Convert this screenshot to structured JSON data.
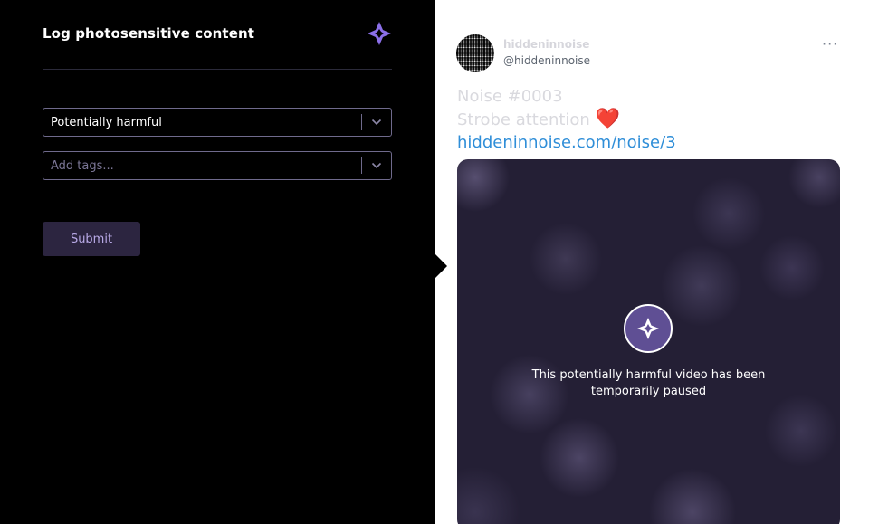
{
  "panel": {
    "title": "Log photosensitive content",
    "severity_select": {
      "value": "Potentially harmful"
    },
    "tags_select": {
      "placeholder": "Add tags..."
    },
    "submit_label": "Submit",
    "colors": {
      "background": "#000000",
      "accent": "#8b6fe8",
      "border": "#6f6a8c"
    }
  },
  "tweet": {
    "display_name": "hiddeninnoise",
    "handle": "@hiddeninnoise",
    "more_label": "···",
    "line1": "Noise #0003",
    "line2": "Strobe attention",
    "heart": "❤️",
    "link": "hiddeninnoise.com/noise/3",
    "video": {
      "status_message": "This potentially harmful video has been temporarily paused",
      "icon": "sparkle-icon"
    },
    "colors": {
      "link": "#2f8ed8",
      "badge": "#5f4f94"
    }
  }
}
